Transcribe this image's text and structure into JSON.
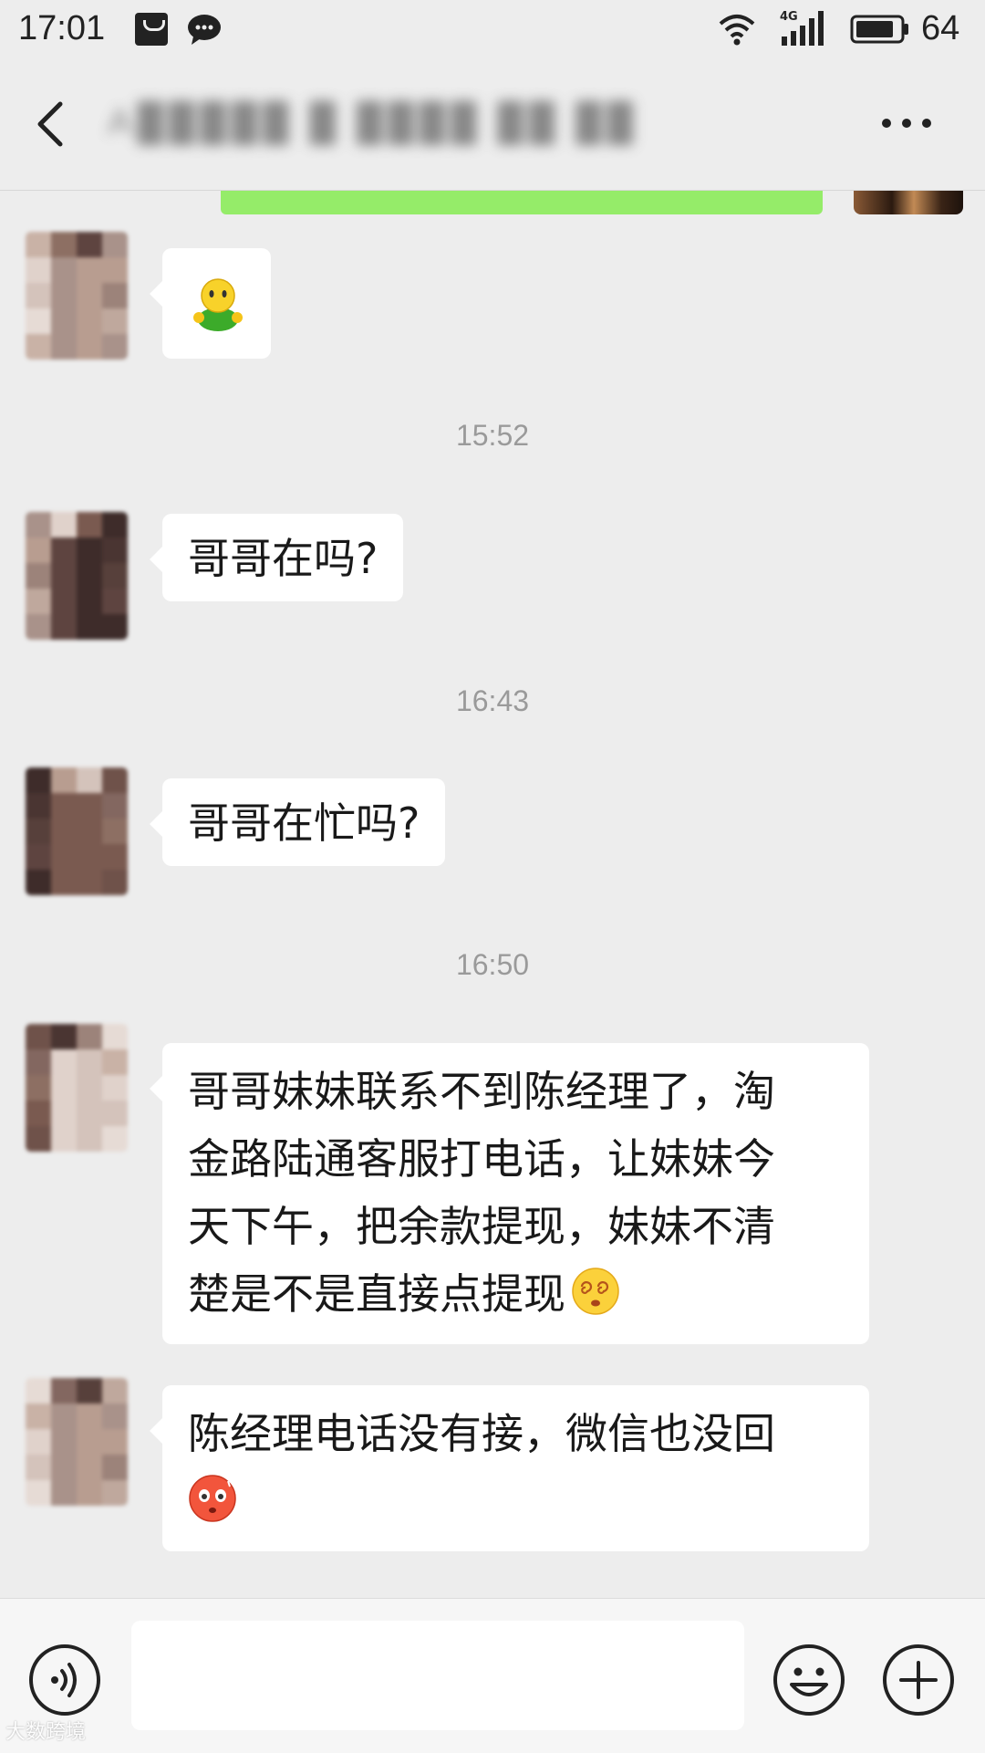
{
  "status_bar": {
    "time": "17:01",
    "network": "4G",
    "battery": "64",
    "icons": [
      "bag-icon",
      "chat-bubble-icon",
      "wifi-icon",
      "signal-icon",
      "battery-icon"
    ]
  },
  "nav": {
    "title_blurred": "A█████ █ ████ ██ ██",
    "icons": [
      "back-arrow-icon",
      "more-dots-icon"
    ]
  },
  "colors": {
    "background": "#ededed",
    "incoming_bubble": "#ffffff",
    "outgoing_bubble": "#95ec69",
    "timestamp": "#9a9a9a"
  },
  "messages": [
    {
      "type": "emoji",
      "emoji": "green-figure-emoji"
    },
    {
      "type": "timestamp",
      "text": "15:52"
    },
    {
      "type": "text",
      "text": "哥哥在吗?"
    },
    {
      "type": "timestamp",
      "text": "16:43"
    },
    {
      "type": "text",
      "text": "哥哥在忙吗?"
    },
    {
      "type": "timestamp",
      "text": "16:50"
    },
    {
      "type": "text",
      "lines": [
        "哥哥妹妹联系不到陈经理了，淘",
        "金路陆通客服打电话，让妹妹今",
        "天下午，把余款提现，妹妹不清",
        "楚是不是直接点提现"
      ],
      "emoji": "dizzy-face-emoji"
    },
    {
      "type": "text",
      "lines": [
        "陈经理电话没有接，微信也没回"
      ],
      "emoji": "blushing-face-emoji"
    }
  ],
  "input_bar": {
    "value": "",
    "icons": [
      "voice-icon",
      "emoji-icon",
      "plus-icon"
    ]
  },
  "watermark": "大数跨境"
}
